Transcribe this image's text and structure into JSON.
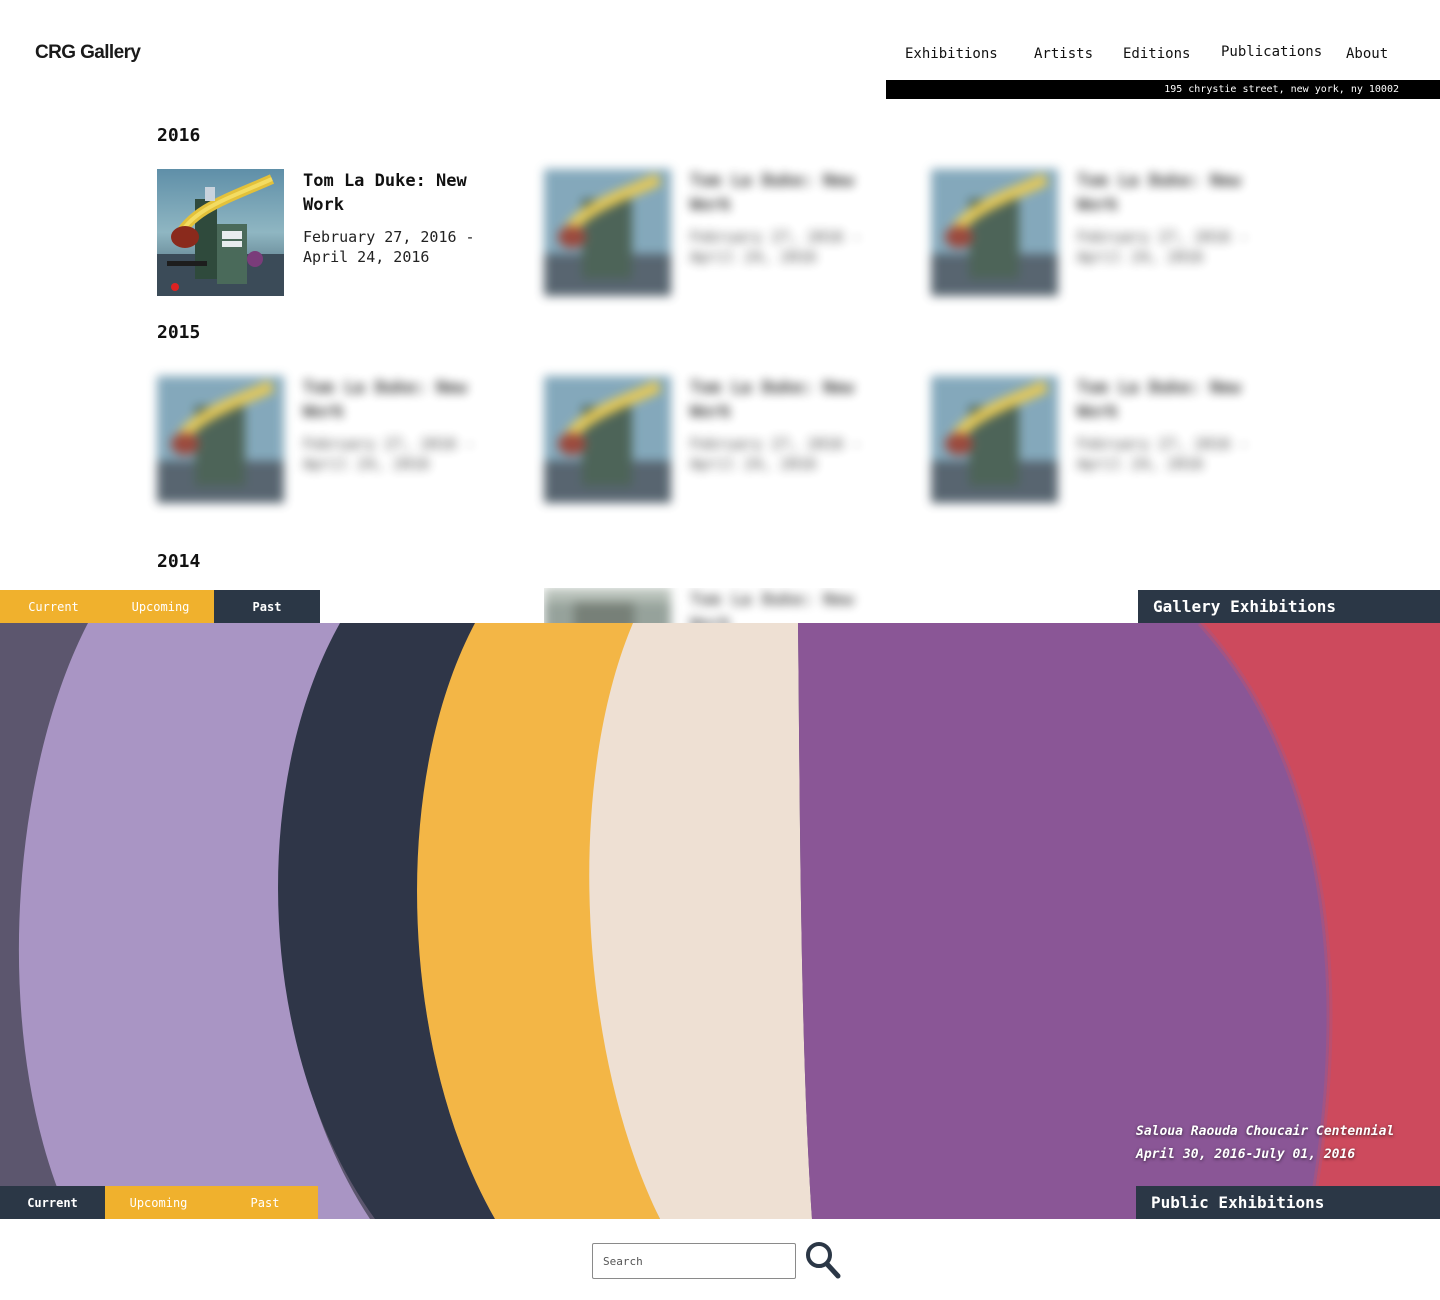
{
  "header": {
    "logo": "CRG Gallery",
    "nav": [
      {
        "id": "exhibitions",
        "label": "Exhibitions"
      },
      {
        "id": "artists",
        "label": "Artists"
      },
      {
        "id": "editions",
        "label": "Editions"
      },
      {
        "id": "publications",
        "label": "Publications"
      },
      {
        "id": "about",
        "label": "About"
      }
    ],
    "address": "195 chrystie street, new york, ny 10002"
  },
  "archive": {
    "years": [
      "2016",
      "2015",
      "2014"
    ],
    "exhibition": {
      "title": "Tom La Duke: New Work",
      "dates": "February 27, 2016 - April 24, 2016"
    }
  },
  "gallery_section": {
    "label": "Gallery Exhibitions",
    "tabs": [
      "Current",
      "Upcoming",
      "Past"
    ],
    "active_tab": "Past"
  },
  "public_section": {
    "label": "Public Exhibitions",
    "tabs": [
      "Current",
      "Upcoming",
      "Past"
    ],
    "active_tab": "Current",
    "caption_title": "Saloua Raouda Choucair Centennial",
    "caption_dates": "April 30, 2016-July 01, 2016"
  },
  "search": {
    "placeholder": "Search",
    "value": ""
  },
  "colors": {
    "accent_yellow": "#f0b12d",
    "tab_dark": "#2b3746",
    "address_bar": "#000000"
  },
  "icons": {
    "search": "magnifier-icon"
  }
}
